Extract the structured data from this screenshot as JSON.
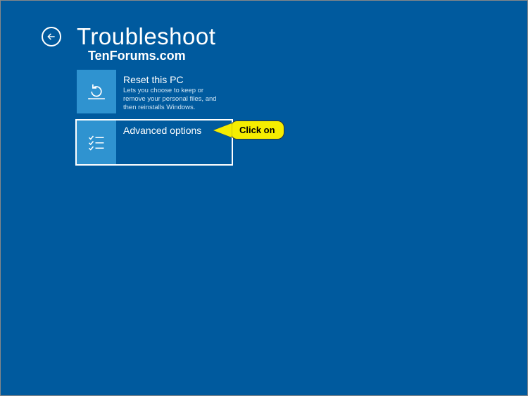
{
  "header": {
    "title": "Troubleshoot"
  },
  "watermark": "TenForums.com",
  "options": [
    {
      "title": "Reset this PC",
      "description": "Lets you choose to keep or remove your personal files, and then reinstalls Windows.",
      "icon": "reset-icon",
      "selected": false
    },
    {
      "title": "Advanced options",
      "description": "",
      "icon": "advanced-icon",
      "selected": true
    }
  ],
  "callout": {
    "label": "Click on"
  }
}
